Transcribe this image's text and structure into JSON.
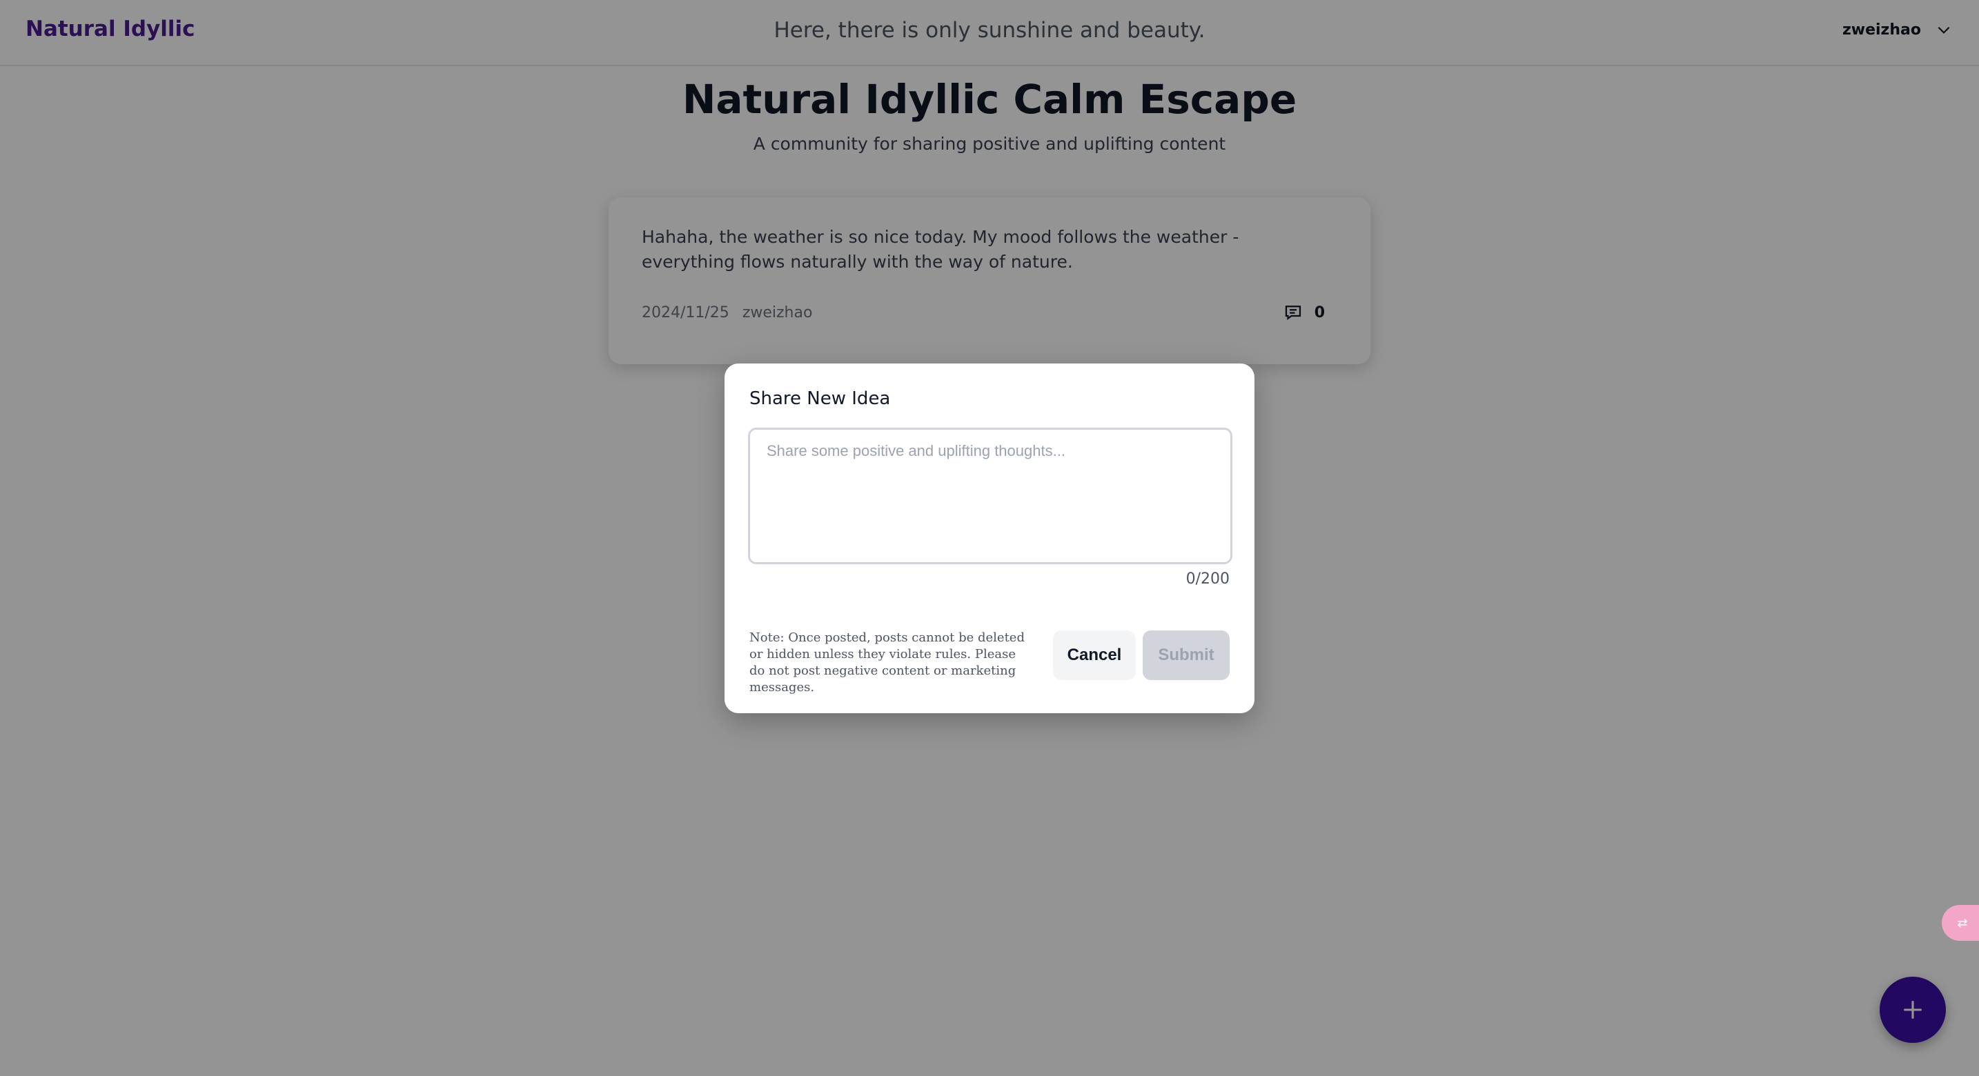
{
  "header": {
    "brand": "Natural Idyllic",
    "tagline": "Here, there is only sunshine and beauty.",
    "username": "zweizhao",
    "dropdown_icon": "chevron-down-icon"
  },
  "hero": {
    "title": "Natural Idyllic Calm Escape",
    "subtitle": "A community for sharing positive and uplifting content"
  },
  "posts": [
    {
      "content": "Hahaha, the weather is so nice today. My mood follows the weather - everything flows naturally with the way of nature.",
      "date": "2024/11/25",
      "author": "zweizhao",
      "comment_icon": "comment-icon",
      "comment_count": "0"
    }
  ],
  "modal": {
    "title": "Share New Idea",
    "placeholder": "Share some positive and uplifting thoughts...",
    "value": "",
    "char_count": "0/200",
    "note": "Note: Once posted, posts cannot be deleted or hidden unless they violate rules. Please do not post negative content or marketing messages.",
    "cancel_label": "Cancel",
    "submit_label": "Submit"
  },
  "fab": {
    "icon": "plus-icon"
  },
  "translate_widget": {
    "icon": "translate-icon"
  },
  "colors": {
    "brand": "#4c1d95",
    "fab": "#3b0ea8",
    "overlay": "rgba(0,0,0,0.42)",
    "submit_disabled_bg": "#d1d5db"
  }
}
